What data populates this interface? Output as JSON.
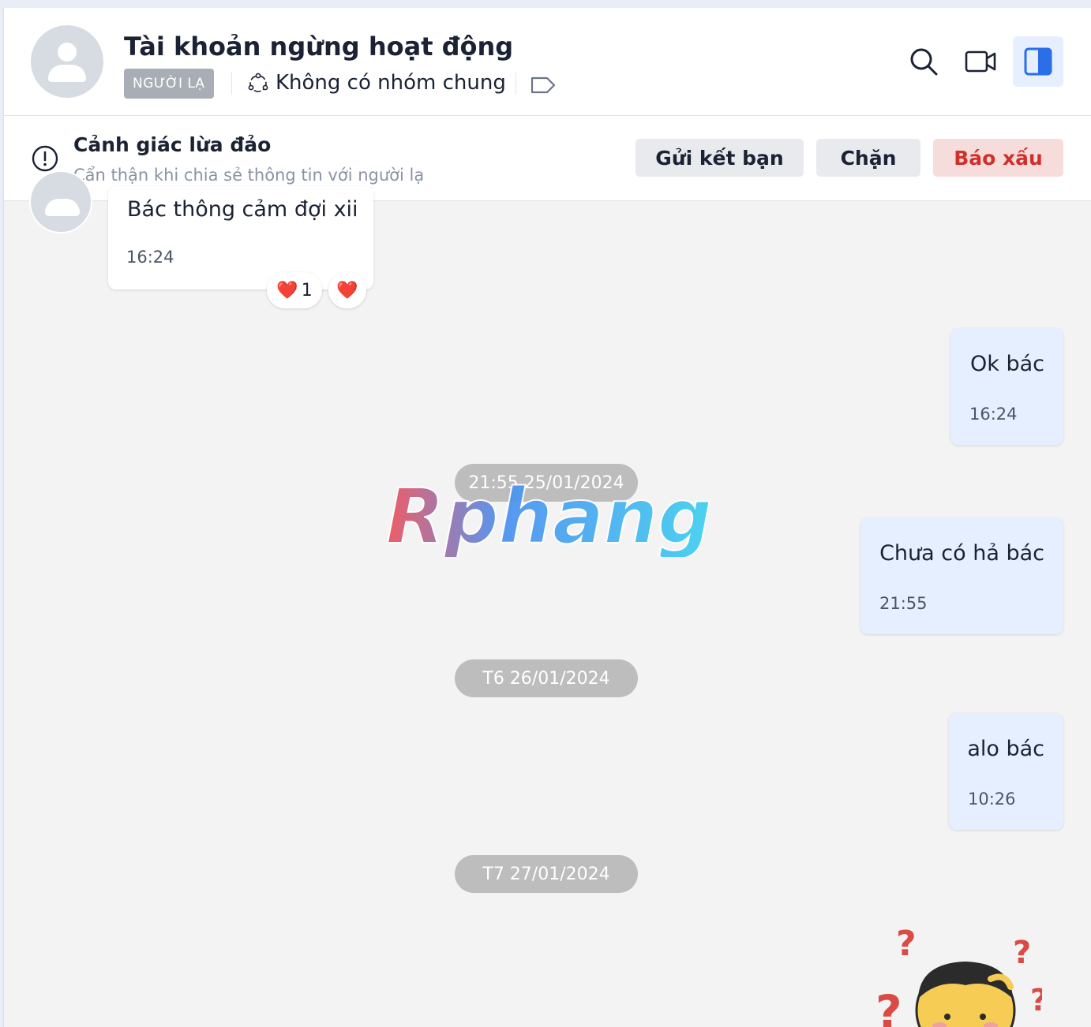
{
  "header": {
    "title": "Tài khoản ngừng hoạt động",
    "badge": "NGƯỜI LẠ",
    "group_text": "Không có nhóm chung",
    "icons": [
      "search-icon",
      "video-call-icon",
      "sidebar-toggle-icon"
    ]
  },
  "warning": {
    "title": "Cảnh giác lừa đảo",
    "subtitle": "Cẩn thận khi chia sẻ thông tin với người lạ",
    "add_friend": "Gửi kết bạn",
    "block": "Chặn",
    "report": "Báo xấu"
  },
  "messages": [
    {
      "dir": "in",
      "text": "Bác thông cảm đợi xii",
      "time": "16:24",
      "reactions": [
        {
          "emoji": "❤️",
          "count": "1"
        },
        {
          "emoji": "❤️",
          "count": ""
        }
      ]
    },
    {
      "dir": "out",
      "text": "Ok bác",
      "time": "16:24"
    },
    {
      "dir": "out",
      "text": "Chưa có hả bác",
      "time": "21:55"
    },
    {
      "dir": "out",
      "text": "alo bác",
      "time": "10:26"
    }
  ],
  "dates": [
    "21:55 25/01/2024",
    "T6 26/01/2024",
    "T7 27/01/2024"
  ],
  "watermark": "Rphang",
  "colors": {
    "accent": "#2a6ee8",
    "danger": "#d0302a",
    "bubble_out": "#e5efff",
    "date_pill": "#bdbdbd"
  }
}
